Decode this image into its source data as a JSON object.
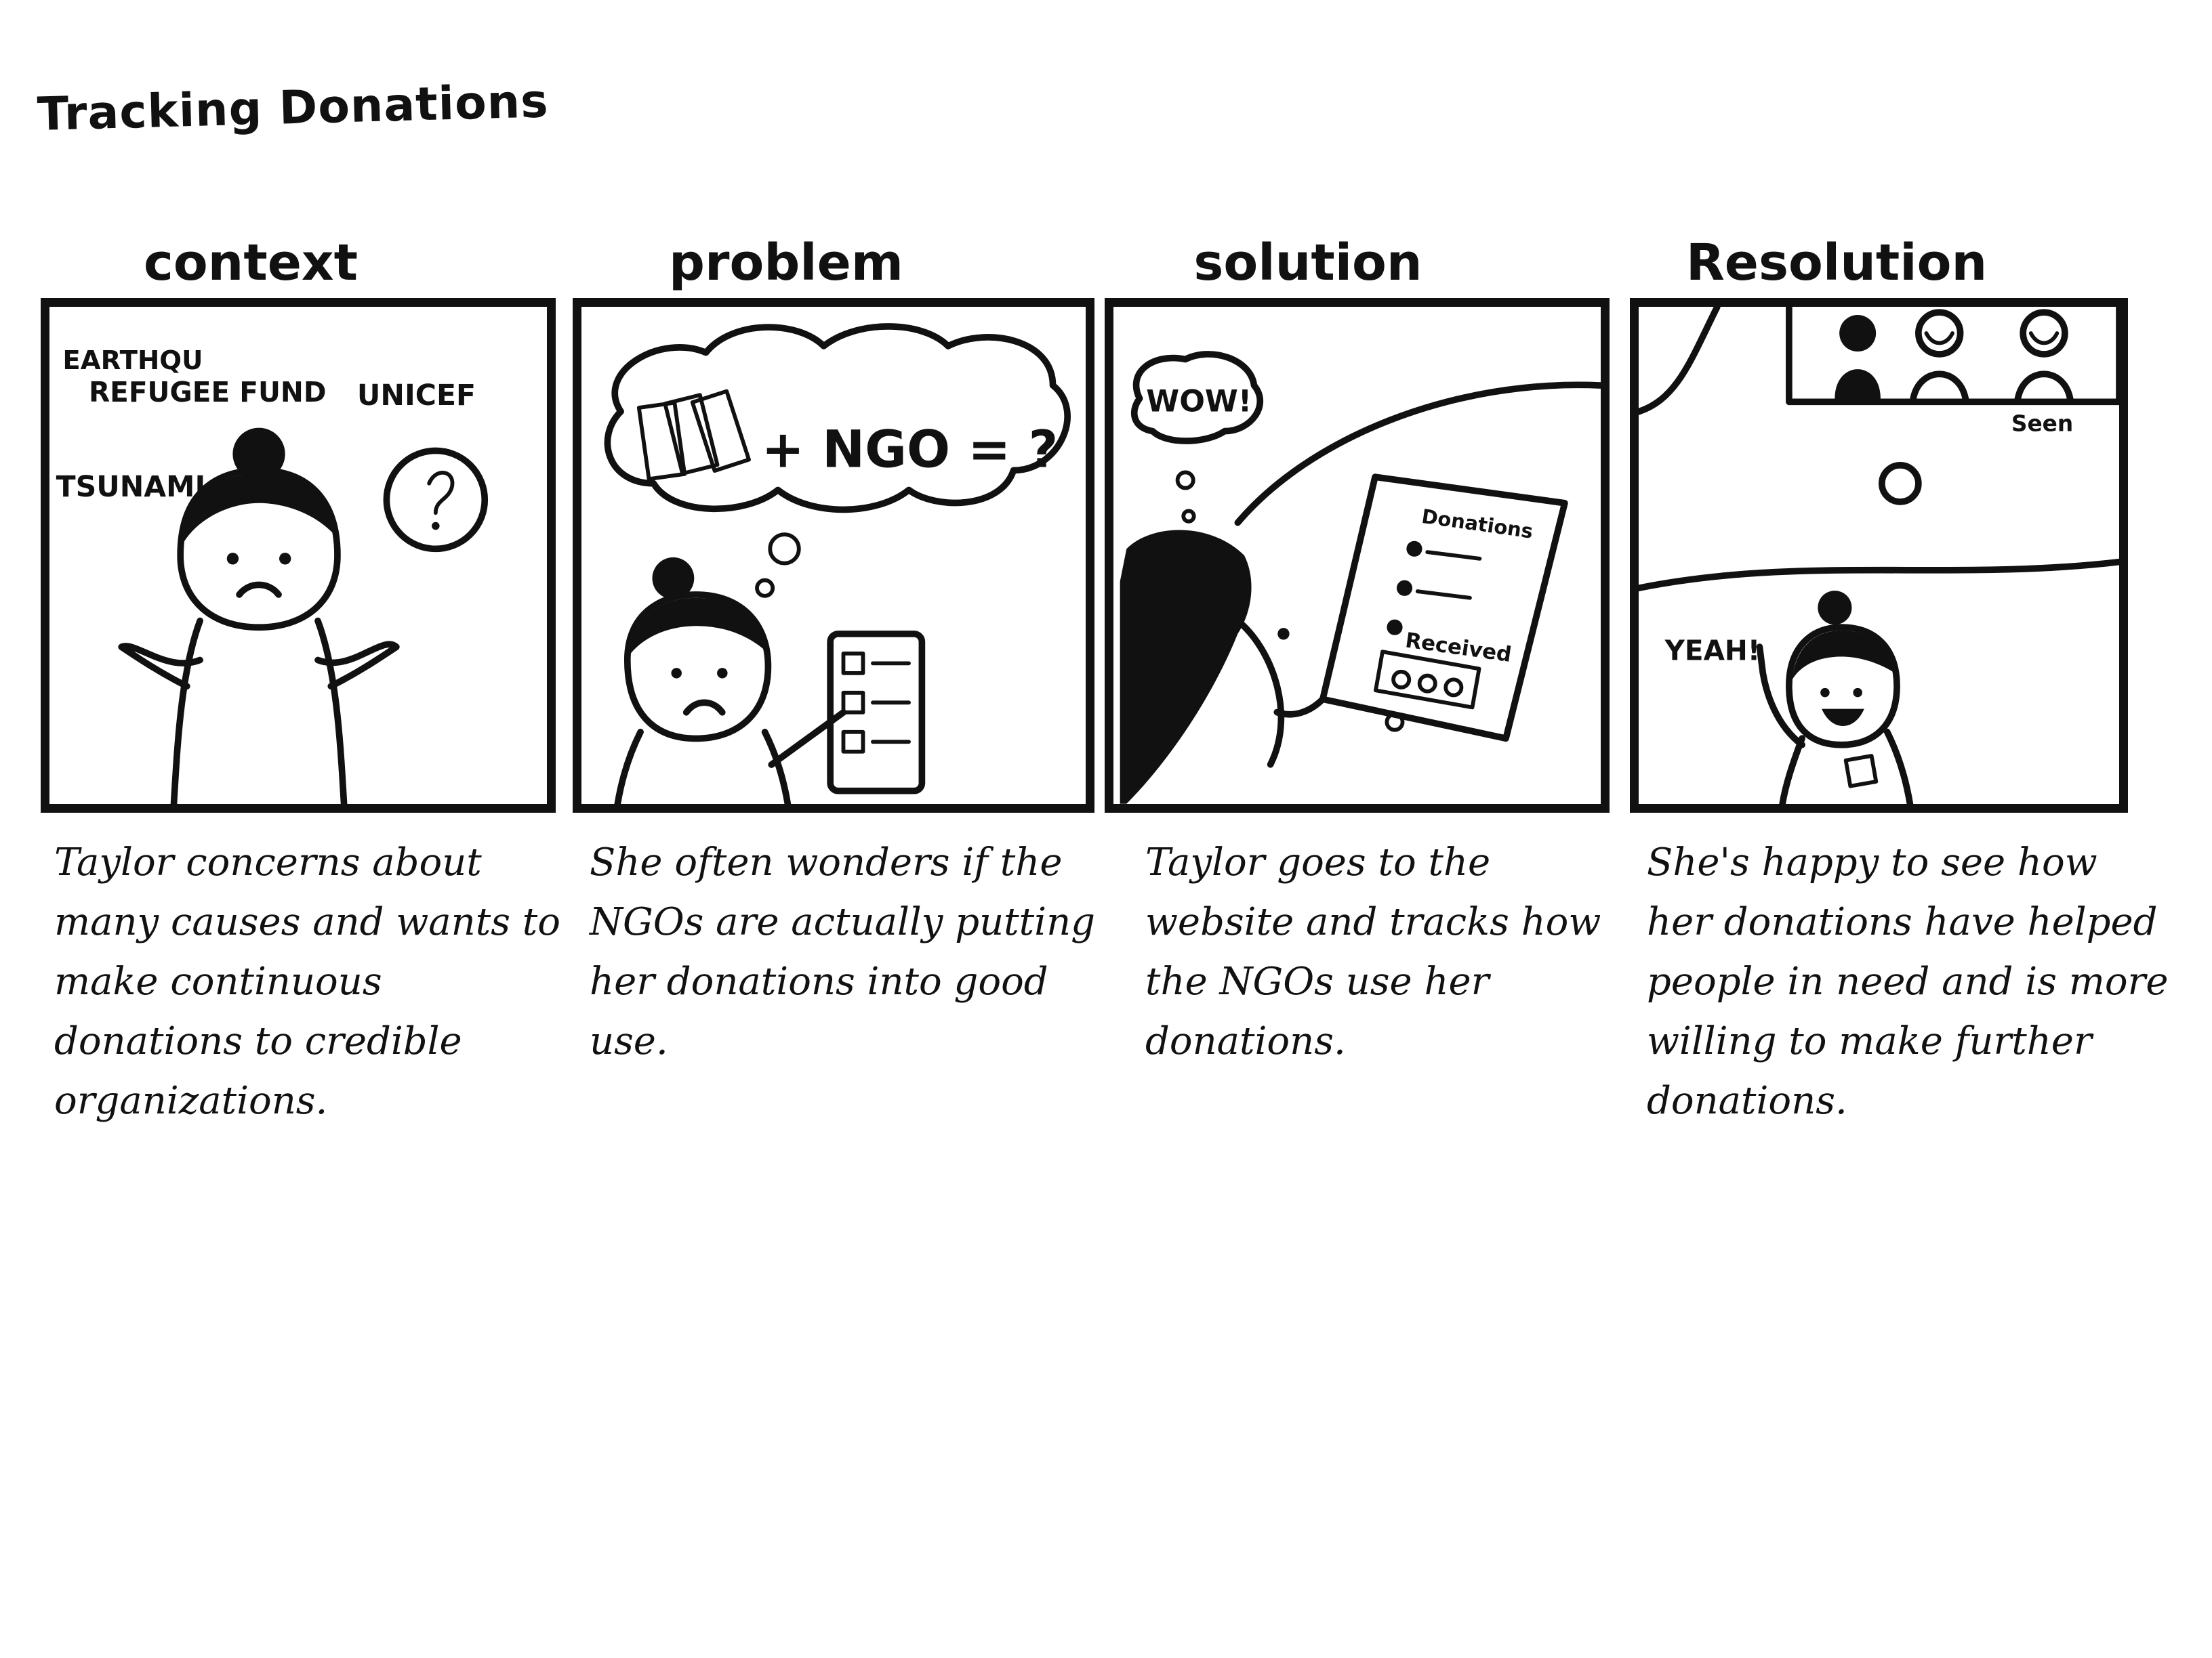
{
  "title": "Tracking Donations",
  "panels": [
    {
      "heading": "context",
      "labels": [
        "EARTHQU",
        "REFUGEE FUND",
        "UNICEF",
        "TSUNAMI"
      ],
      "caption": "Taylor concerns about many causes and wants to make continuous donations to credible organizations."
    },
    {
      "heading": "problem",
      "labels": [
        "+ NGO = ?"
      ],
      "caption": "She often wonders if the NGOs are actually putting her donations into good use."
    },
    {
      "heading": "solution",
      "labels": [
        "WOW!",
        "Donations",
        "Received"
      ],
      "caption": "Taylor goes to the website and tracks how the NGOs use her donations."
    },
    {
      "heading": "Resolution",
      "labels": [
        "Seen",
        "YEAH!"
      ],
      "caption": "She's happy to see how her donations have helped people in need and is more willing to make further donations."
    }
  ]
}
